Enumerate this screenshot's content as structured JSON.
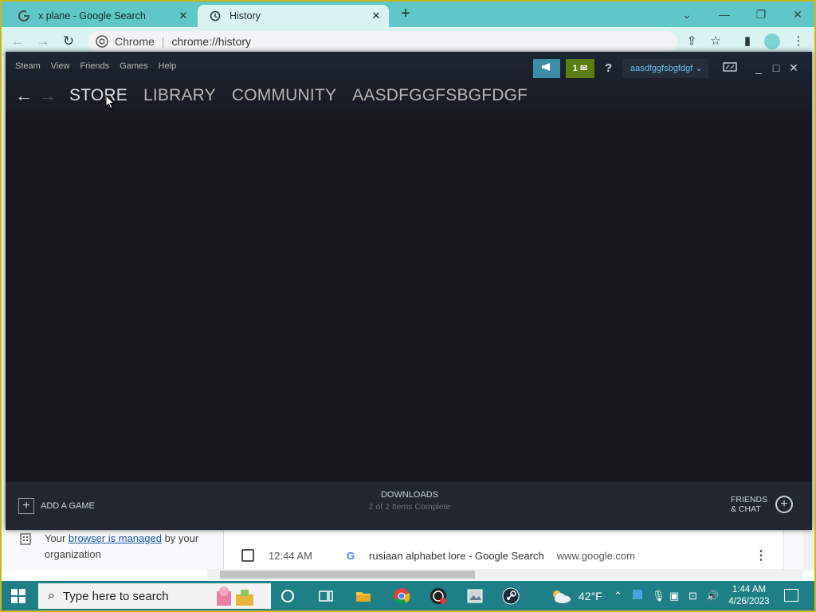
{
  "browser": {
    "tabs": [
      {
        "title": "x plane - Google Search",
        "favicon": "google-g-icon"
      },
      {
        "title": "History",
        "favicon": "history-icon"
      }
    ],
    "site_name": "Chrome",
    "url": "chrome://history"
  },
  "steam": {
    "menu": [
      "Steam",
      "View",
      "Friends",
      "Games",
      "Help"
    ],
    "notification_count": "1",
    "help_label": "?",
    "account_name": "aasdfggfsbgfdgf",
    "nav": [
      "STORE",
      "LIBRARY",
      "COMMUNITY",
      "AASDFGGFSBGFDGF"
    ],
    "active_nav": "STORE",
    "footer": {
      "add_game": "ADD A GAME",
      "downloads_title": "DOWNLOADS",
      "downloads_status": "2 of 2 Items Complete",
      "friends_line1": "FRIENDS",
      "friends_line2": "& CHAT"
    }
  },
  "history_page": {
    "managed_prefix": "Your ",
    "managed_link": "browser is managed",
    "managed_suffix": " by your organization",
    "entries": [
      {
        "time": "12:44 AM",
        "title": "rusiaan alphabet lore - Google Search",
        "domain": "www.google.com"
      }
    ]
  },
  "taskbar": {
    "search_placeholder": "Type here to search",
    "temperature": "42°F",
    "time": "1:44 AM",
    "date": "4/26/2023"
  },
  "colors": {
    "tab_strip": "#5fc6c9",
    "steam_bg": "#171a21",
    "steam_link": "#66c0f4",
    "steam_notif": "#5c7e10",
    "taskbar": "#1e7f88"
  }
}
